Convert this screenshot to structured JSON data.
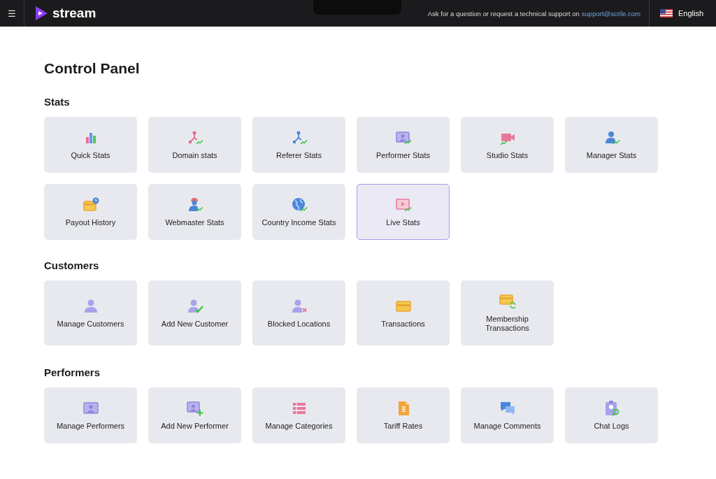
{
  "header": {
    "menu_glyph": "☰",
    "logo_text": "stream",
    "support_text": "Ask for a question or request a technical support on",
    "support_link": "support@scrile.com",
    "language": "English"
  },
  "page_title": "Control Panel",
  "sections": [
    {
      "title": "Stats",
      "tiles": [
        {
          "label": "Quick Stats",
          "highlighted": false
        },
        {
          "label": "Domain stats",
          "highlighted": false
        },
        {
          "label": "Referer Stats",
          "highlighted": false
        },
        {
          "label": "Performer Stats",
          "highlighted": false
        },
        {
          "label": "Studio Stats",
          "highlighted": false
        },
        {
          "label": "Manager Stats",
          "highlighted": false
        },
        {
          "label": "Payout History",
          "highlighted": false
        },
        {
          "label": "Webmaster Stats",
          "highlighted": false
        },
        {
          "label": "Country Income Stats",
          "highlighted": false
        },
        {
          "label": "Live Stats",
          "highlighted": true
        }
      ]
    },
    {
      "title": "Customers",
      "tiles": [
        {
          "label": "Manage Customers",
          "highlighted": false
        },
        {
          "label": "Add New Customer",
          "highlighted": false
        },
        {
          "label": "Blocked Locations",
          "highlighted": false
        },
        {
          "label": "Transactions",
          "highlighted": false
        },
        {
          "label": "Membership Transactions",
          "highlighted": false
        }
      ]
    },
    {
      "title": "Performers",
      "tiles": [
        {
          "label": "Manage Performers",
          "highlighted": false
        },
        {
          "label": "Add New Performer",
          "highlighted": false
        },
        {
          "label": "Manage Categories",
          "highlighted": false
        },
        {
          "label": "Tariff Rates",
          "highlighted": false
        },
        {
          "label": "Manage Comments",
          "highlighted": false
        },
        {
          "label": "Chat Logs",
          "highlighted": false
        }
      ]
    }
  ]
}
